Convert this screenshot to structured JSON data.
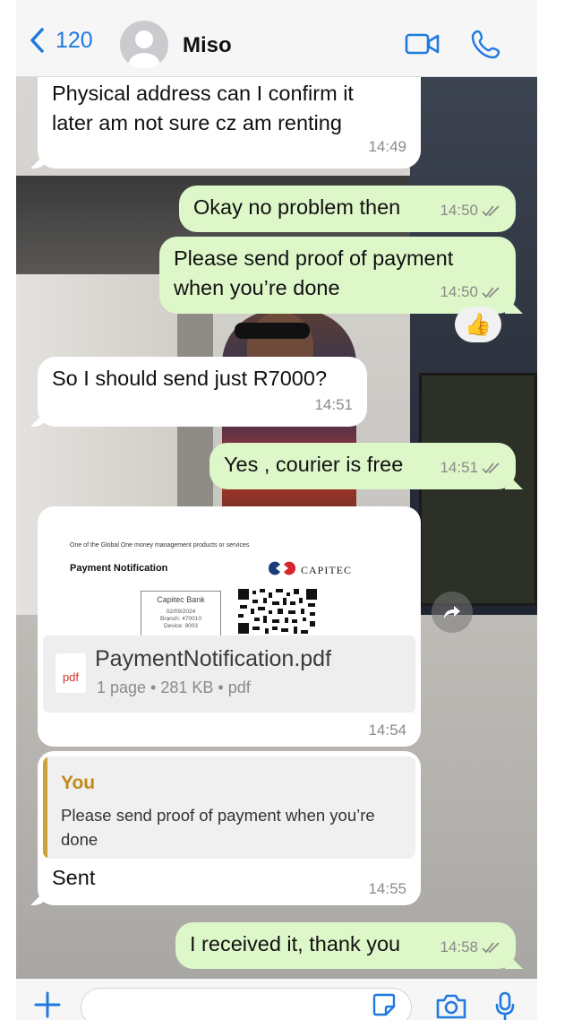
{
  "header": {
    "back_count": "120",
    "contact_name": "Miso",
    "icons": [
      "chevron-left-icon",
      "avatar",
      "video-call-icon",
      "phone-icon"
    ],
    "accent_color": "#1f7ae0"
  },
  "messages": [
    {
      "direction": "in",
      "text": "Physical address can I confirm it later am not sure cz am renting",
      "time": "14:49"
    },
    {
      "direction": "out",
      "text": "Okay no problem then",
      "time": "14:50"
    },
    {
      "direction": "out",
      "text": "Please send proof of payment when you’re done",
      "time": "14:50",
      "reaction": "👍"
    },
    {
      "direction": "in",
      "text": "So I should send just R7000?",
      "time": "14:51"
    },
    {
      "direction": "out",
      "text": "Yes , courier is free",
      "time": "14:51"
    }
  ],
  "document": {
    "preview_tagline": "One of the Global One money management products or services",
    "preview_heading": "Payment Notification",
    "brand": "CAPITEC",
    "stamp_title": "Capitec Bank",
    "stamp_lines": [
      "02/09/2024",
      "Branch: 470010",
      "Device: 9003"
    ],
    "icon_label": "pdf",
    "file_name": "PaymentNotification.pdf",
    "file_meta": "1 page • 281 KB • pdf",
    "time": "14:54"
  },
  "reply": {
    "quoted_author": "You",
    "quoted_text": "Please send proof of payment when you’re done",
    "text": "Sent",
    "time": "14:55"
  },
  "last_message": {
    "direction": "out",
    "text": "I received it, thank you",
    "time": "14:58"
  },
  "composer": {
    "placeholder": ""
  },
  "colors": {
    "outgoing_bubble": "#ddf7c9",
    "incoming_bubble": "#ffffff",
    "quote_bar": "#c9a23a"
  }
}
